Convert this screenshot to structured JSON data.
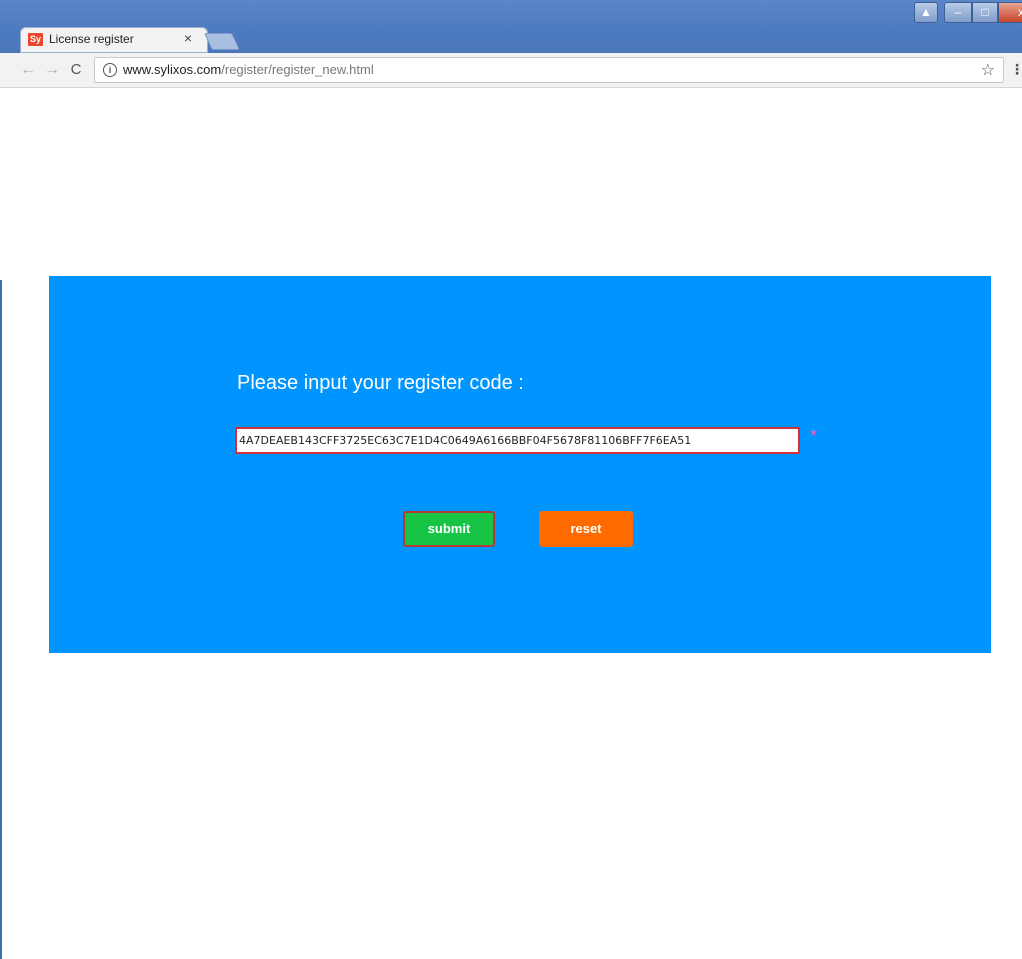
{
  "browser": {
    "tab_title": "License register",
    "favicon_text": "Sy",
    "tab_close": "×",
    "url_host": "www.sylixos.com",
    "url_path": "/register/register_new.html",
    "back_icon": "←",
    "forward_icon": "→",
    "reload_icon": "C",
    "star_icon": "☆",
    "menu_icon": "⋮",
    "window_controls": {
      "minimize": "–",
      "maximize": "□",
      "close": "x"
    }
  },
  "form": {
    "prompt": "Please input your register code :",
    "code_value": "4A7DEAEB143CFF3725EC63C7E1D4C0649A6166BBF04F5678F81106BFF7F6EA51",
    "required_mark": "*",
    "submit_label": "submit",
    "reset_label": "reset"
  },
  "colors": {
    "panel_bg": "#0095fe",
    "submit_bg": "#17c446",
    "reset_bg": "#ff6a00",
    "input_border": "#d5303a",
    "required_mark": "#ff5bb0"
  }
}
